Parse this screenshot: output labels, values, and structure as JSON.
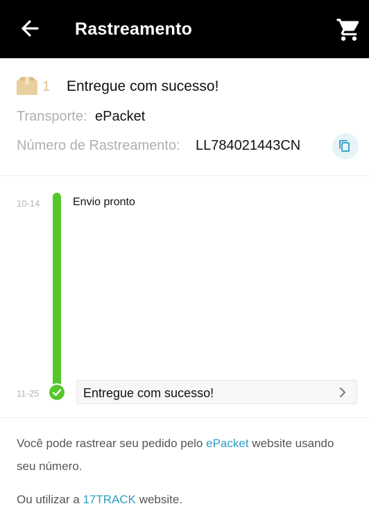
{
  "header": {
    "title": "Rastreamento",
    "back_icon": "arrow-left-icon",
    "cart_icon": "shopping-cart-icon"
  },
  "package": {
    "icon": "package-box-icon",
    "count": "1",
    "status": "Entregue com sucesso!",
    "transport_label": "Transporte:",
    "transport_value": "ePacket",
    "tracking_label": "Número de Rastreamento:",
    "tracking_number": "LL784021443CN",
    "copy_icon": "copy-icon"
  },
  "timeline": {
    "events": [
      {
        "date": "10-14",
        "text": "Envio pronto"
      },
      {
        "date": "11-25",
        "text": "Entregue com sucesso!"
      }
    ]
  },
  "footer": {
    "line1_prefix": "Você pode rastrear seu pedido pelo ",
    "line1_link": "ePacket",
    "line1_suffix": " website usando",
    "line2": "seu número.",
    "line3_prefix": "Ou utilizar a ",
    "line3_link": "17TRACK",
    "line3_suffix": " website."
  },
  "colors": {
    "header_bg": "#000000",
    "accent_green": "#55c72b",
    "link": "#2e9cc2",
    "box": "#e8cf9f"
  }
}
